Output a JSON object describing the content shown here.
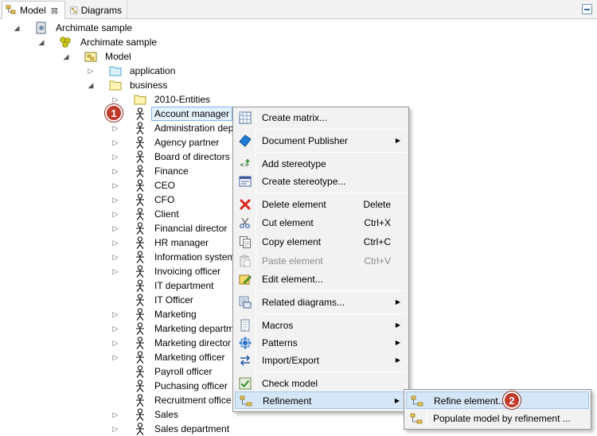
{
  "tabs": [
    {
      "label": "Model",
      "icon": "model-icon",
      "close": "⊠"
    },
    {
      "label": "Diagrams",
      "icon": "diagrams-icon"
    }
  ],
  "tree": {
    "root": "Archimate sample",
    "project": "Archimate sample",
    "model": "Model",
    "application": "application",
    "business": "business",
    "entities": "2010-Entities",
    "actors": [
      "Account manager",
      "Administration dep",
      "Agency partner",
      "Board of directors",
      "Finance",
      "CEO",
      "CFO",
      "Client",
      "Financial director",
      "HR manager",
      "Information system",
      "Invoicing officer",
      "IT department",
      "IT Officer",
      "Marketing",
      "Marketing departm",
      "Marketing director",
      "Marketing officer",
      "Payroll officer",
      "Puchasing officer",
      "Recruitment office",
      "Sales",
      "Sales department"
    ]
  },
  "callouts": {
    "first": "1",
    "second": "2"
  },
  "menu": {
    "create_matrix": "Create matrix...",
    "document_publisher": "Document Publisher",
    "add_stereotype": "Add stereotype",
    "create_stereotype": "Create stereotype...",
    "delete_element": "Delete element",
    "delete_key": "Delete",
    "cut_element": "Cut element",
    "cut_key": "Ctrl+X",
    "copy_element": "Copy element",
    "copy_key": "Ctrl+C",
    "paste_element": "Paste element",
    "paste_key": "Ctrl+V",
    "edit_element": "Edit element...",
    "related_diagrams": "Related diagrams...",
    "macros": "Macros",
    "patterns": "Patterns",
    "import_export": "Import/Export",
    "check_model": "Check model",
    "refinement": "Refinement",
    "submenu_arrow": "▶"
  },
  "submenu": {
    "refine_element": "Refine element...",
    "populate_model": "Populate model by refinement ..."
  },
  "colors": {
    "accent": "#d5e6f7",
    "badge": "#c0392b",
    "folder": "#fff5b5"
  }
}
